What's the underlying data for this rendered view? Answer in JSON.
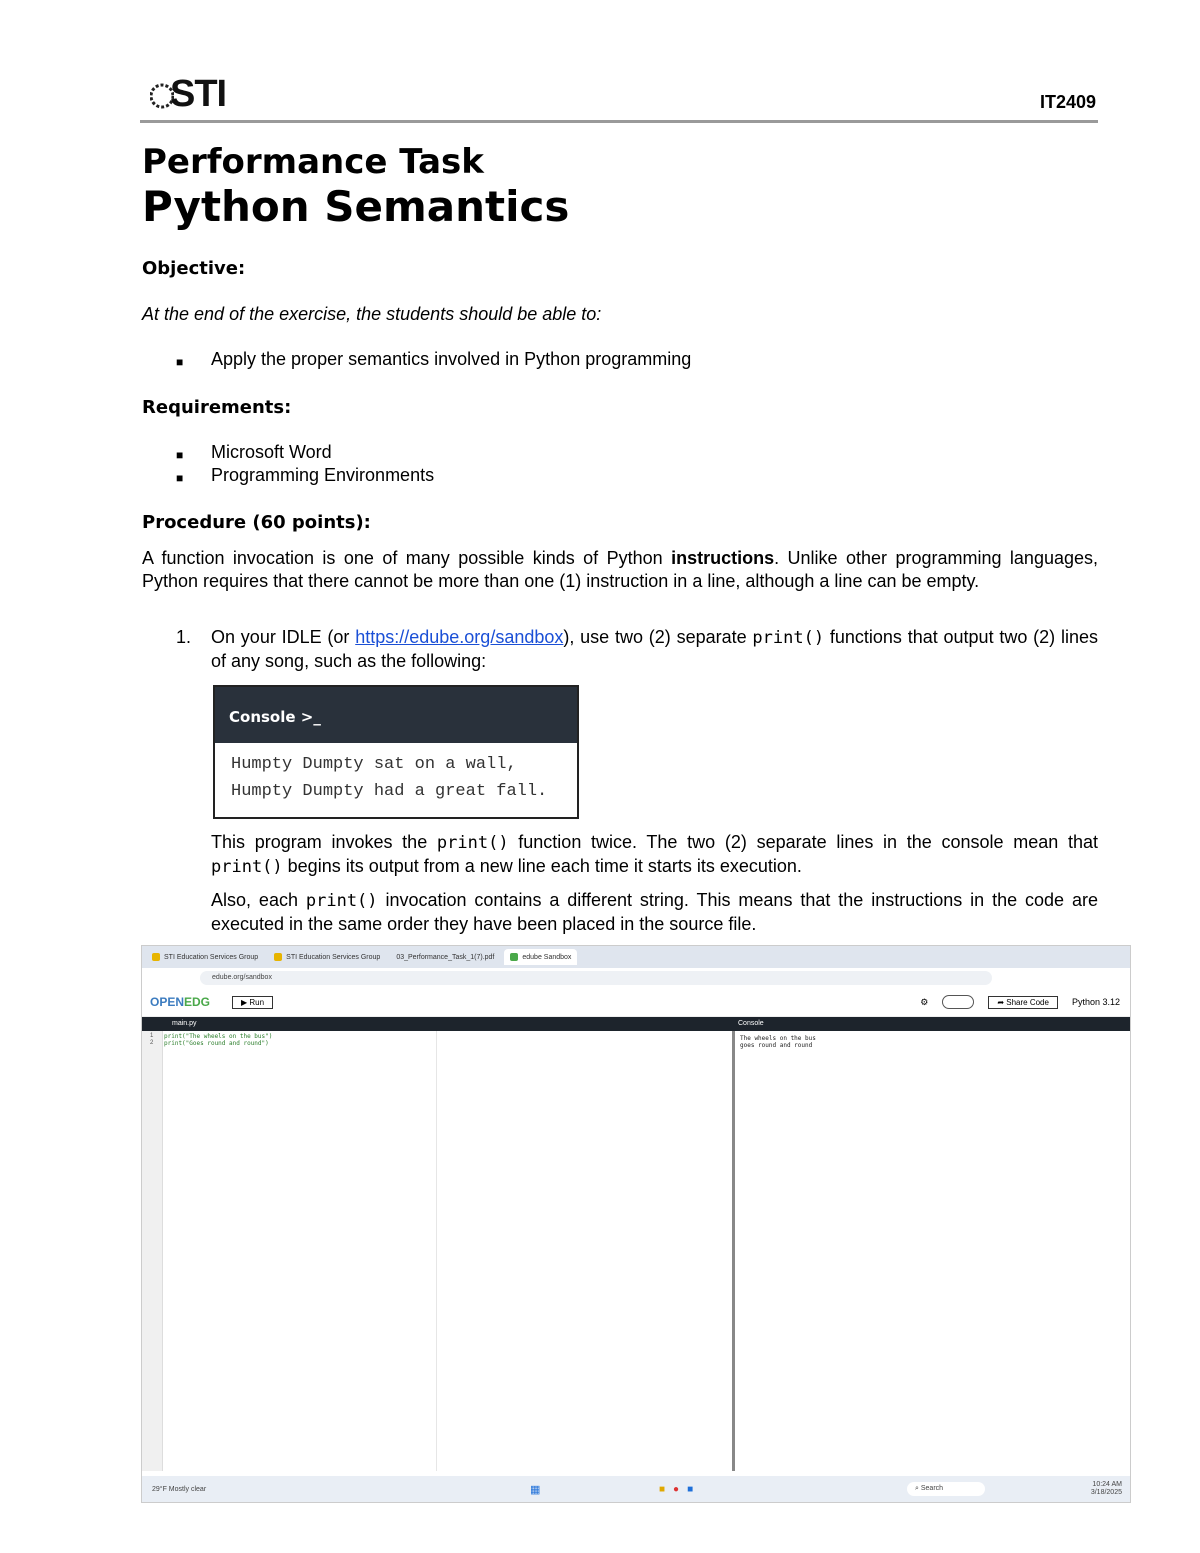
{
  "header": {
    "logo_text": "STI",
    "course_code": "IT2409"
  },
  "title": {
    "line1": "Performance Task",
    "line2": "Python Semantics"
  },
  "objective": {
    "heading": "Objective:",
    "intro": "At the end of the exercise, the students should be able to:",
    "items": [
      "Apply the proper semantics involved in Python programming"
    ]
  },
  "requirements": {
    "heading": "Requirements:",
    "items": [
      "Microsoft Word",
      "Programming Environments"
    ]
  },
  "procedure": {
    "heading": "Procedure (60 points):",
    "intro_pre": "A function invocation is one of many possible kinds of Python ",
    "intro_bold": "instructions",
    "intro_post": ". Unlike other programming languages, Python requires that there cannot be more than one (1) instruction in a line, although a line can be empty.",
    "step1_num": "1.",
    "step1_pre": "On your IDLE (or ",
    "step1_link": "https://edube.org/sandbox",
    "step1_mid": "), use two (2) separate ",
    "step1_code": "print()",
    "step1_post": " functions that output two (2) lines of any song, such as the following:",
    "console_title": "Console >_",
    "console_lines": [
      "Humpty Dumpty sat on a wall,",
      "Humpty Dumpty had a great fall."
    ],
    "p2_pre": "This program invokes the ",
    "p2_code1": "print()",
    "p2_mid": " function twice. The two (2) separate lines in the console mean that ",
    "p2_code2": "print()",
    "p2_post": " begins its output from a new line each time it starts its execution.",
    "p3_pre": "Also, each ",
    "p3_code": "print()",
    "p3_post": " invocation contains a different string. This means that the instructions in the code are executed in the same order they have been placed in the source file."
  },
  "screenshot": {
    "tabs": [
      "STI Education Services Group",
      "STI Education Services Group",
      "03_Performance_Task_1(7).pdf",
      "edube Sandbox"
    ],
    "url": "edube.org/sandbox",
    "brand_a": "OPEN",
    "brand_b": "EDG",
    "run_label": "▶ Run",
    "share_label": "Share Code",
    "python_version": "Python 3.12",
    "editor_tab": "main.py",
    "console_tab": "Console",
    "gutter_lines": [
      "1",
      "2"
    ],
    "code_lines": [
      "print(\"The wheels on the bus\")",
      "print(\"Goes round and round\")"
    ],
    "output_lines": [
      "The wheels on the bus",
      "goes round and round"
    ],
    "taskbar_weather": "29°F Mostly clear",
    "taskbar_search": "Search",
    "taskbar_time": "10:24 AM",
    "taskbar_date": "3/18/2025"
  },
  "icons": [
    "bullet-square-icon",
    "settings-gear-icon",
    "share-icon",
    "windows-start-icon",
    "search-icon",
    "chrome-icon"
  ]
}
